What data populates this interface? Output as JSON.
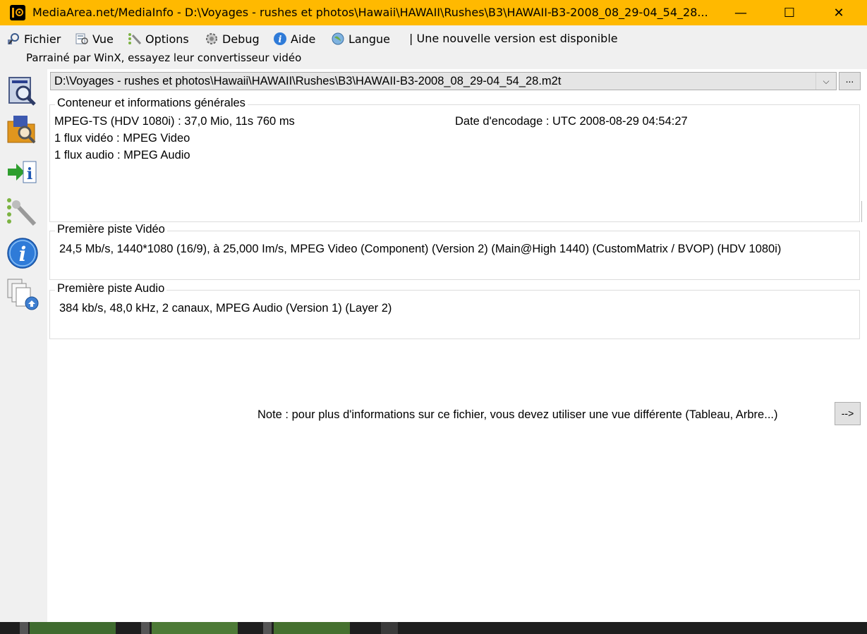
{
  "window": {
    "title": "MediaArea.net/MediaInfo - D:\\Voyages - rushes et photos\\Hawaii\\HAWAII\\Rushes\\B3\\HAWAII-B3-2008_08_29-04_54_28...",
    "minimize_glyph": "—",
    "maximize_glyph": "☐",
    "close_glyph": "✕",
    "titlebar_color": "#ffb900"
  },
  "menu": {
    "items": [
      {
        "label": "Fichier",
        "icon": "file-icon"
      },
      {
        "label": "Vue",
        "icon": "view-icon"
      },
      {
        "label": "Options",
        "icon": "options-icon"
      },
      {
        "label": "Debug",
        "icon": "debug-icon"
      },
      {
        "label": "Aide",
        "icon": "help-icon"
      },
      {
        "label": "Langue",
        "icon": "globe-icon"
      }
    ],
    "update_notice": "| Une nouvelle version est disponible"
  },
  "sponsor_text": "Parrainé par WinX, essayez leur convertisseur vidéo",
  "toolbar": {
    "icons": [
      "open-file-icon",
      "open-folder-icon",
      "export-icon",
      "preferences-icon",
      "info-icon",
      "about-icon"
    ]
  },
  "file_selector": {
    "value": "D:\\Voyages - rushes et photos\\Hawaii\\HAWAII\\Rushes\\B3\\HAWAII-B3-2008_08_29-04_54_28.m2t",
    "arrow_glyph": "⌵",
    "browse_label": "..."
  },
  "general": {
    "legend": "Conteneur et informations générales",
    "lines": [
      "MPEG-TS (HDV 1080i) : 37,0 Mio, 11s 760 ms",
      "1 flux vidéo : MPEG Video",
      "1 flux audio : MPEG Audio"
    ],
    "encoding_date": "Date d'encodage : UTC 2008-08-29 04:54:27"
  },
  "video": {
    "legend": "Première piste Vidéo",
    "line": "24,5 Mb/s, 1440*1080 (16/9), à 25,000 Im/s, MPEG Video (Component) (Version 2) (Main@High 1440) (CustomMatrix / BVOP) (HDV 1080i)"
  },
  "audio": {
    "legend": "Première piste Audio",
    "line": "384 kb/s, 48,0 kHz, 2 canaux, MPEG Audio (Version 1) (Layer 2)"
  },
  "note": {
    "text": "Note : pour plus d'informations sur ce fichier, vous devez utiliser une vue différente (Tableau, Arbre...)",
    "button_label": "-->"
  }
}
